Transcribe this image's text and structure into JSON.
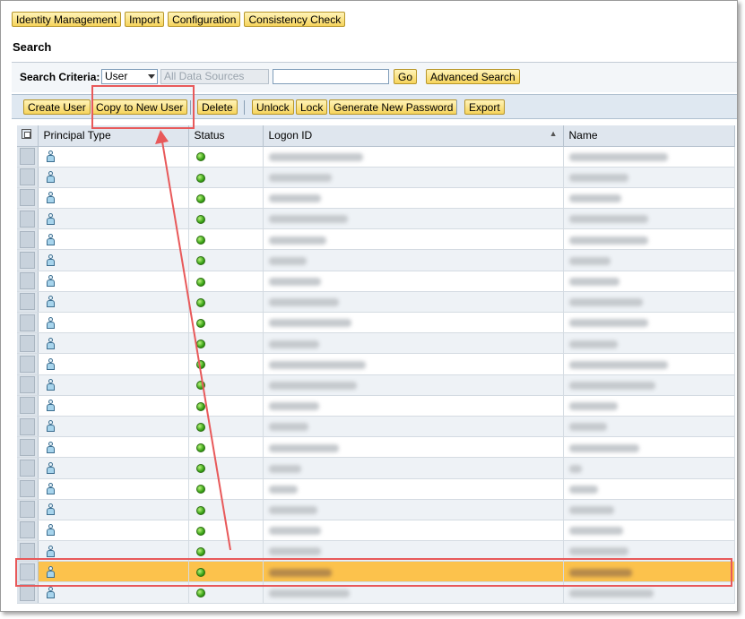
{
  "topbar": {
    "buttons": [
      "Identity Management",
      "Import",
      "Configuration",
      "Consistency Check"
    ]
  },
  "search": {
    "title": "Search",
    "criteria_label": "Search Criteria:",
    "criteria_value": "User",
    "data_source_placeholder": "All Data Sources",
    "query_value": "",
    "go_label": "Go",
    "advanced_label": "Advanced Search"
  },
  "toolbar": {
    "create_user": "Create User",
    "copy_to_new_user": "Copy to New User",
    "delete": "Delete",
    "unlock": "Unlock",
    "lock": "Lock",
    "generate_new_password": "Generate New Password",
    "export": "Export"
  },
  "table": {
    "columns": [
      "Principal Type",
      "Status",
      "Logon ID",
      "Name"
    ],
    "sorted_column": "Logon ID",
    "row_count": 22,
    "selected_row_index": 20,
    "principal_type_icon": "user-icon",
    "status_icon": "green-status-icon"
  },
  "colors": {
    "button_yellow": "#f6d45c",
    "toolbar_blue": "#dfe8f1",
    "selected_row": "#fcc24c",
    "annotation_red": "#e8595a",
    "status_green": "#3aa317"
  }
}
